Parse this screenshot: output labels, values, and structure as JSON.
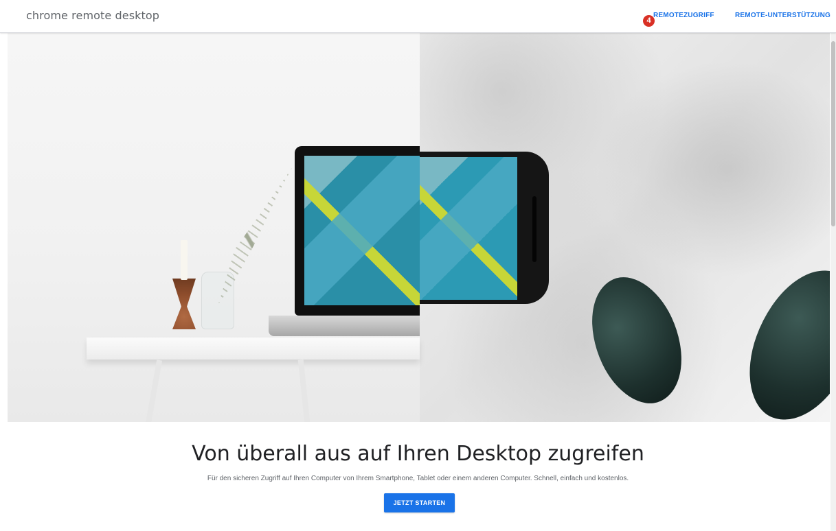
{
  "header": {
    "logo": "chrome remote desktop",
    "nav": [
      {
        "label": "REMOTEZUGRIFF"
      },
      {
        "label": "REMOTE-UNTERSTÜTZUNG"
      }
    ],
    "badge_count": "4"
  },
  "main": {
    "title": "Von überall aus auf Ihren Desktop zugreifen",
    "subtitle": "Für den sicheren Zugriff auf Ihren Computer von Ihrem Smartphone, Tablet oder einem anderen Computer. Schnell, einfach und kostenlos.",
    "cta_label": "JETZT STARTEN"
  },
  "colors": {
    "accent": "#1a73e8",
    "badge": "#d93025",
    "text": "#202124"
  },
  "icons": {
    "badge": "notification-badge-icon"
  }
}
